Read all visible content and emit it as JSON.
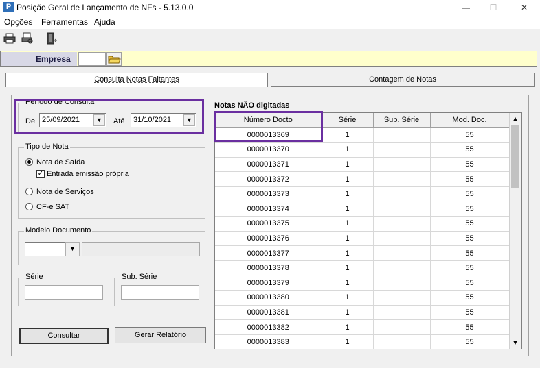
{
  "window": {
    "title": "Posição Geral de Lançamento de NFs - 5.13.0.0",
    "app_icon_letter": "P",
    "minimize": "—",
    "maximize": "☐",
    "close": "✕"
  },
  "menu": [
    "Opções",
    "Ferramentas",
    "Ajuda"
  ],
  "toolbar": {
    "icons": [
      "printer-icon",
      "print-preview-icon",
      "exit-door-icon"
    ]
  },
  "empresa": {
    "label": "Empresa",
    "value": ""
  },
  "tabs": [
    {
      "label": "Consulta Notas Faltantes",
      "active": true
    },
    {
      "label": "Contagem de Notas",
      "active": false
    }
  ],
  "periodo": {
    "title": "Período de Consulta",
    "de_label": "De",
    "de_value": "25/09/2021",
    "ate_label": "Até",
    "ate_value": "31/10/2021"
  },
  "tipo_nota": {
    "title": "Tipo de Nota",
    "options": [
      "Nota de Saída",
      "Nota de Serviços",
      "CF-e SAT"
    ],
    "selected": "Nota de Saída",
    "checkbox_label": "Entrada emissão própria",
    "checkbox_checked": true
  },
  "modelo": {
    "title": "Modelo Documento",
    "value": "",
    "description": ""
  },
  "serie": {
    "title": "Série",
    "value": ""
  },
  "sub_serie": {
    "title": "Sub. Série",
    "value": ""
  },
  "buttons": {
    "consultar": "Consultar",
    "gerar": "Gerar Relatório"
  },
  "grid": {
    "title": "Notas NÃO digitadas",
    "columns": [
      "Número Docto",
      "Série",
      "Sub. Série",
      "Mod. Doc."
    ],
    "rows": [
      [
        "0000013369",
        "1",
        "",
        "55"
      ],
      [
        "0000013370",
        "1",
        "",
        "55"
      ],
      [
        "0000013371",
        "1",
        "",
        "55"
      ],
      [
        "0000013372",
        "1",
        "",
        "55"
      ],
      [
        "0000013373",
        "1",
        "",
        "55"
      ],
      [
        "0000013374",
        "1",
        "",
        "55"
      ],
      [
        "0000013375",
        "1",
        "",
        "55"
      ],
      [
        "0000013376",
        "1",
        "",
        "55"
      ],
      [
        "0000013377",
        "1",
        "",
        "55"
      ],
      [
        "0000013378",
        "1",
        "",
        "55"
      ],
      [
        "0000013379",
        "1",
        "",
        "55"
      ],
      [
        "0000013380",
        "1",
        "",
        "55"
      ],
      [
        "0000013381",
        "1",
        "",
        "55"
      ],
      [
        "0000013382",
        "1",
        "",
        "55"
      ],
      [
        "0000013383",
        "1",
        "",
        "55"
      ]
    ]
  },
  "colors": {
    "highlight": "#6a2fa0",
    "empresa_bg": "#ffffcc"
  }
}
